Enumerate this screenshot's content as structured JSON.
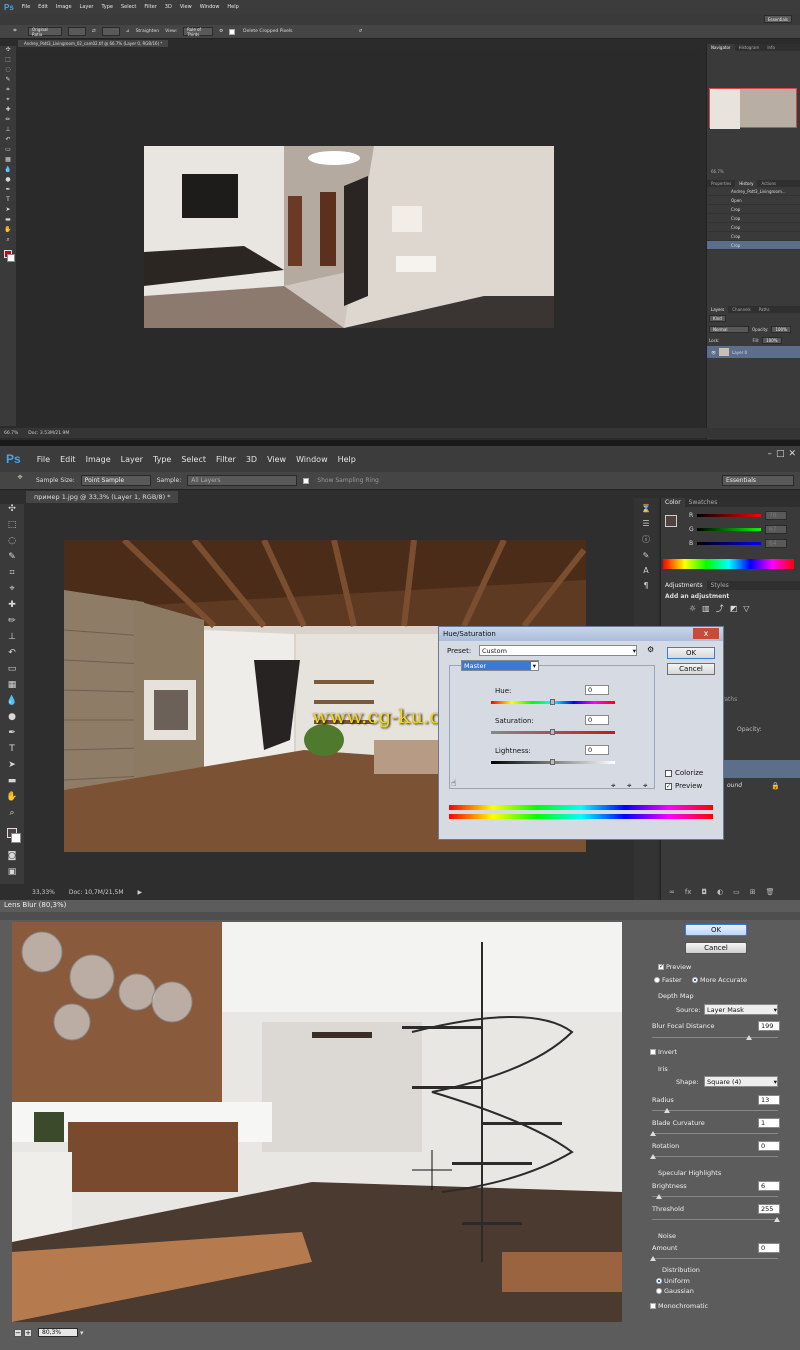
{
  "shot1": {
    "app_logo": "Ps",
    "menu": [
      "File",
      "Edit",
      "Image",
      "Layer",
      "Type",
      "Select",
      "Filter",
      "3D",
      "View",
      "Window",
      "Help"
    ],
    "workspace": "Essentials",
    "options": {
      "ratio": "Original Ratio",
      "straighten": "Straighten",
      "view": "View:",
      "view_value": "Rule of Thirds",
      "delete_cropped": "Delete Cropped Pixels"
    },
    "doc_tab": "Andrey_Pott3_Livingroom_02_cam02.tif @ 66.7% (Layer 0, RGB/16) *",
    "status": {
      "zoom": "66.7%",
      "doc": "Doc: 3.53M/21.9M"
    },
    "panels": {
      "tabs_top": [
        "Navigator",
        "Histogram",
        "Info"
      ],
      "tabs_mid": [
        "Properties",
        "History",
        "Actions"
      ],
      "zoom": "66.7%",
      "history_snapshot": "Andrey_Pott3_Livingroom...",
      "history": [
        "Open",
        "Crop",
        "Crop",
        "Crop",
        "Crop",
        "Crop"
      ],
      "layer_tabs": [
        "Layers",
        "Channels",
        "Paths"
      ],
      "kind": "Kind",
      "blend": "Normal",
      "opacity_label": "Opacity:",
      "opacity": "100%",
      "lock": "Lock:",
      "fill_label": "Fill:",
      "fill": "100%",
      "layer_name": "Layer 0"
    }
  },
  "shot2": {
    "app_logo": "Ps",
    "menu": [
      "File",
      "Edit",
      "Image",
      "Layer",
      "Type",
      "Select",
      "Filter",
      "3D",
      "View",
      "Window",
      "Help"
    ],
    "workspace": "Essentials",
    "options": {
      "sample_size_label": "Sample Size:",
      "sample_size": "Point Sample",
      "sample_label": "Sample:",
      "sample": "All Layers",
      "show_ring": "Show Sampling Ring"
    },
    "doc_tab": "пример 1.jpg @ 33,3% (Layer 1, RGB/8) *",
    "status": {
      "zoom": "33,33%",
      "doc": "Doc: 10,7M/21,5M"
    },
    "color_panel": {
      "tabs": [
        "Color",
        "Swatches"
      ],
      "channels": [
        {
          "label": "R",
          "value": "78"
        },
        {
          "label": "G",
          "value": "67"
        },
        {
          "label": "B",
          "value": "64"
        }
      ]
    },
    "adjust_panel": {
      "tabs": [
        "Adjustments",
        "Styles"
      ],
      "title": "Add an adjustment"
    },
    "layers_panel": {
      "tabs_partial": "Paths",
      "opacity_label": "Opacity:",
      "layer_fragment": "ound"
    },
    "dialog": {
      "title": "Hue/Saturation",
      "close": "x",
      "preset_label": "Preset:",
      "preset": "Custom",
      "channel": "Master",
      "ok": "OK",
      "cancel": "Cancel",
      "hue_label": "Hue:",
      "hue": "0",
      "sat_label": "Saturation:",
      "sat": "0",
      "light_label": "Lightness:",
      "light": "0",
      "colorize": "Colorize",
      "preview": "Preview"
    },
    "watermark": "www.cg-ku.com"
  },
  "shot3": {
    "title": "Lens Blur (80,3%)",
    "ok": "OK",
    "cancel": "Cancel",
    "preview": "Preview",
    "faster": "Faster",
    "more_accurate": "More Accurate",
    "depth_map": "Depth Map",
    "source_label": "Source:",
    "source": "Layer Mask",
    "blur_focal_label": "Blur Focal Distance",
    "blur_focal": "199",
    "invert": "Invert",
    "iris": "Iris",
    "shape_label": "Shape:",
    "shape": "Square (4)",
    "radius_label": "Radius",
    "radius": "13",
    "blade_label": "Blade Curvature",
    "blade": "1",
    "rotation_label": "Rotation",
    "rotation": "0",
    "specular": "Specular Highlights",
    "brightness_label": "Brightness",
    "brightness": "6",
    "threshold_label": "Threshold",
    "threshold": "255",
    "noise": "Noise",
    "amount_label": "Amount",
    "amount": "0",
    "distribution": "Distribution",
    "uniform": "Uniform",
    "gaussian": "Gaussian",
    "monochromatic": "Monochromatic",
    "zoom": "80,3%"
  }
}
